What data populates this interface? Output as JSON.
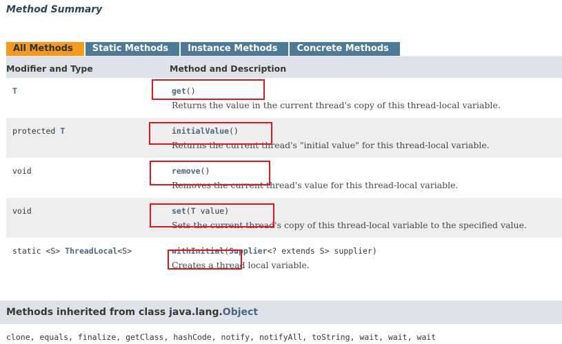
{
  "section_title": "Method Summary",
  "tabs": [
    "All Methods",
    "Static Methods",
    "Instance Methods",
    "Concrete Methods"
  ],
  "columns": {
    "modifier_type": "Modifier and Type",
    "method_desc": "Method and Description"
  },
  "rows": [
    {
      "modifier_prefix": "",
      "modifier_link": "T",
      "modifier_suffix": "",
      "method": "get",
      "params": "()",
      "description": "Returns the value in the current thread's copy of this thread-local variable."
    },
    {
      "modifier_prefix": "protected ",
      "modifier_link": "T",
      "modifier_suffix": "",
      "method": "initialValue",
      "params": "()",
      "description": "Returns the current thread's \"initial value\" for this thread-local variable."
    },
    {
      "modifier_prefix": "void",
      "modifier_link": "",
      "modifier_suffix": "",
      "method": "remove",
      "params": "()",
      "description": "Removes the current thread's value for this thread-local variable."
    },
    {
      "modifier_prefix": "void",
      "modifier_link": "",
      "modifier_suffix": "",
      "method": "set",
      "params_open": "(",
      "params_link": "T",
      "params_rest": " value)",
      "description": "Sets the current thread's copy of this thread-local variable to the specified value."
    },
    {
      "modifier_prefix": "static <S> ",
      "modifier_link": "ThreadLocal",
      "modifier_suffix": "<S>",
      "method": "withInitial",
      "params_open": "(",
      "params_link": "Supplier",
      "params_rest": "<? extends S> supplier)",
      "description": "Creates a thread local variable."
    }
  ],
  "inherited": {
    "prefix": "Methods inherited from class java.lang.",
    "class_link": "Object",
    "methods": "clone, equals, finalize, getClass, hashCode, notify, notifyAll, toString, wait, wait, wait"
  }
}
